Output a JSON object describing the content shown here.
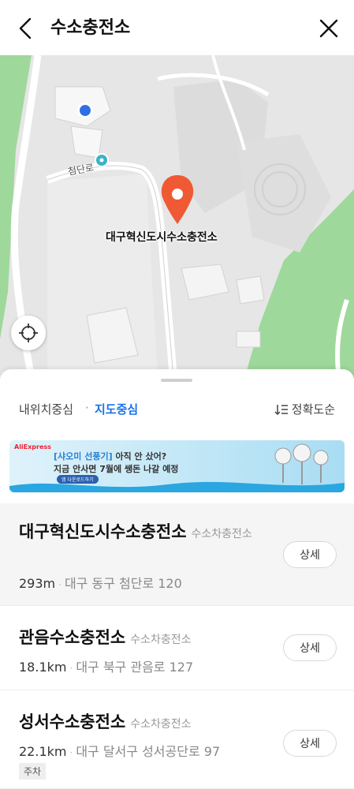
{
  "header": {
    "title": "수소충전소"
  },
  "map": {
    "place_label": "대구혁신도시수소충전소",
    "road_label": "첨단로"
  },
  "filters": {
    "my_location": "내위치중심",
    "separator": "·",
    "map_center": "지도중심",
    "sort_label": "정확도순"
  },
  "ad": {
    "brand": "AliExpress",
    "line1_bracket": "[샤오미 선풍기]",
    "line1_rest": " 아직 안 샀어?",
    "line2": "지금 안사면 7월에 쌩돈 나갈 예정",
    "cta": "앱 다운로드하기"
  },
  "results": [
    {
      "name": "대구혁신도시수소충전소",
      "category": "수소차충전소",
      "distance": "293m",
      "address": "대구 동구 첨단로 120",
      "detail_label": "상세"
    },
    {
      "name": "관음수소충전소",
      "category": "수소차충전소",
      "distance": "18.1km",
      "address": "대구 북구 관음로 127",
      "detail_label": "상세"
    },
    {
      "name": "성서수소충전소",
      "category": "수소차충전소",
      "distance": "22.1km",
      "address": "대구 달서구 성서공단로 97",
      "detail_label": "상세",
      "tag": "주차"
    }
  ],
  "colors": {
    "accent": "#1a73e8",
    "marker": "#ef5a35",
    "park": "#8fd18a",
    "map_bg": "#e6e6e6"
  }
}
